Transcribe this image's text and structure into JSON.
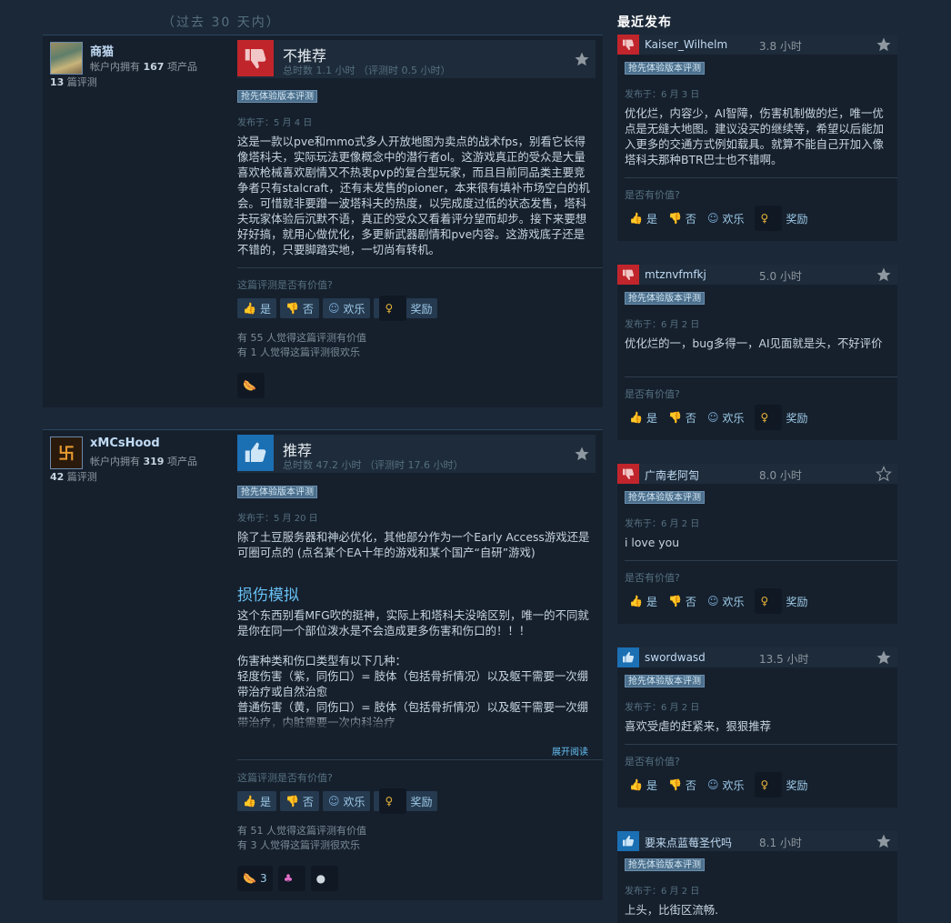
{
  "period": "（过去 30 天内）",
  "recent_title": "最近发布",
  "common": {
    "early_access_badge": "抢先体验版本评测",
    "helpful_question_main": "这篇评测是否有价值?",
    "helpful_question_side": "是否有价值?",
    "vote_yes": "是",
    "vote_no": "否",
    "vote_funny": "欢乐",
    "vote_award": "奖励",
    "read_more": "展开阅读"
  },
  "reviews": [
    {
      "username": "商猫",
      "owned_prefix": "帐户内拥有 ",
      "owned_count": "167",
      "owned_suffix": " 项产品",
      "review_count": "13",
      "review_count_suffix": " 篇评测",
      "verdict": "不推荐",
      "recommended": false,
      "hours": "总时数 1.1 小时 （评测时 0.5 小时）",
      "posted": "发布于：5 月 4 日",
      "body": "这是一款以pve和mmo式多人开放地图为卖点的战术fps，别看它长得像塔科夫，实际玩法更像概念中的潜行者ol。这游戏真正的受众是大量喜欢枪械喜欢剧情又不热衷pvp的复合型玩家，而且目前同品类主要竞争者只有stalcraft，还有未发售的pioner，本来很有填补市场空白的机会。可惜就非要蹭一波塔科夫的热度，以完成度过低的状态发售，塔科夫玩家体验后沉默不语，真正的受众又看着评分望而却步。接下来要想好好搞，就用心做优化，多更新武器剧情和pve内容。这游戏底子还是不错的，只要脚踏实地，一切尚有转机。",
      "helpful_stat": "有 55 人觉得这篇评测有价值",
      "funny_stat": "有 1 人觉得这篇评测很欢乐"
    },
    {
      "username": "xMCsHood",
      "owned_prefix": "帐户内拥有 ",
      "owned_count": "319",
      "owned_suffix": " 项产品",
      "review_count": "42",
      "review_count_suffix": " 篇评测",
      "verdict": "推荐",
      "recommended": true,
      "hours": "总时数 47.2 小时 （评测时 17.6 小时）",
      "posted": "发布于：5 月 20 日",
      "body_intro": "除了土豆服务器和神必优化，其他部分作为一个Early Access游戏还是可圈可点的 (点名某个EA十年的游戏和某个国产“自研”游戏)",
      "section_title": "损伤模拟",
      "section_text": "这个东西别看MFG吹的挺神，实际上和塔科夫没啥区别，唯一的不同就是你在同一个部位泼水是不会造成更多伤害和伤口的！！！",
      "list_intro": "伤害种类和伤口类型有以下几种：",
      "list_line1": "轻度伤害（紫，同伤口）= 肢体（包括骨折情况）以及躯干需要一次绷带治疗或自然治愈",
      "list_line2": "普通伤害（黄，同伤口）= 肢体（包括骨折情况）以及躯干需要一次绷带治疗，内脏需要一次内科治疗",
      "helpful_stat": "有 51 人觉得这篇评测有价值",
      "funny_stat": "有 3 人觉得这篇评测很欢乐",
      "award_count": "3"
    }
  ],
  "recent": [
    {
      "username": "Kaiser_Wilhelm",
      "hours": "3.8 小时",
      "recommended": false,
      "posted": "发布于：6 月 3 日",
      "body": "优化烂，内容少，AI智障，伤害机制做的烂，唯一优点是无缝大地图。建议没买的继续等，希望以后能加入更多的交通方式例如载具。就算不能自己开加入像塔科夫那种BTR巴士也不错啊。"
    },
    {
      "username": "mtznvfmfkj",
      "hours": "5.0 小时",
      "recommended": false,
      "posted": "发布于：6 月 2 日",
      "body": "优化烂的一，bug多得一，AI见面就是头，不好评价"
    },
    {
      "username": "广南老阿訇",
      "hours": "8.0 小时",
      "recommended": false,
      "posted": "发布于：6 月 2 日",
      "body": "i love you"
    },
    {
      "username": "swordwasd",
      "hours": "13.5 小时",
      "recommended": true,
      "posted": "发布于：6 月 2 日",
      "body": "喜欢受虐的赶紧来，狠狠推荐"
    },
    {
      "username": "要来点蓝莓圣代吗",
      "hours": "8.1 小时",
      "recommended": true,
      "posted": "发布于：6 月 2 日",
      "body": "上头，比街区流畅."
    }
  ]
}
